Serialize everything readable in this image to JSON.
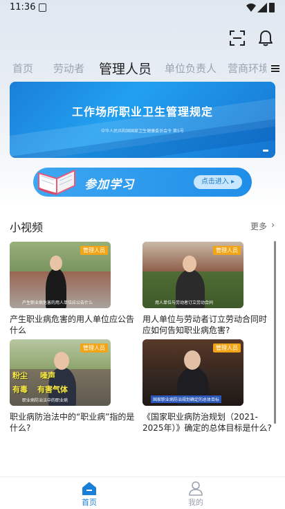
{
  "status_bar": {
    "time": "11:36"
  },
  "tabs": [
    "首页",
    "劳动者",
    "管理人员",
    "单位负责人",
    "营商环境"
  ],
  "active_tab_index": 2,
  "banner": {
    "title": "工作场所职业卫生管理规定",
    "subtitle": "中华人民共和国国家卫生健康委员会令 第5号"
  },
  "study": {
    "label": "参加学习",
    "enter_button": "点击进入 ▸"
  },
  "videos_section": {
    "title": "小视频",
    "more": "更多",
    "items": [
      {
        "badge": "管理人员",
        "title": "产生职业病危害的用人单位应公告什么",
        "caption": "产生职业病危害的用人单位应公告什么"
      },
      {
        "badge": "管理人员",
        "title": "用人单位与劳动者订立劳动合同时应如何告知职业病危害?",
        "caption": "用人单位与劳动者订立劳动合同"
      },
      {
        "badge": "管理人员",
        "title": "职业病防治法中的“职业病”指的是什么?",
        "caption": "职业病防治法中的职业病",
        "overlay_text": [
          "粉尘",
          "噪声",
          "有毒",
          "有害气体"
        ]
      },
      {
        "badge": "管理人员",
        "title": "《国家职业病防治规划（2021-2025年）》确定的总体目标是什么?",
        "caption": "国家职业病防治规划确定的总体目标"
      }
    ]
  },
  "bottom_nav": [
    {
      "label": "首页",
      "active": true
    },
    {
      "label": "我的",
      "active": false
    }
  ],
  "colors": {
    "accent": "#1a7fd8",
    "badge": "#f2a516",
    "tab_inactive": "#9aa3b0"
  }
}
